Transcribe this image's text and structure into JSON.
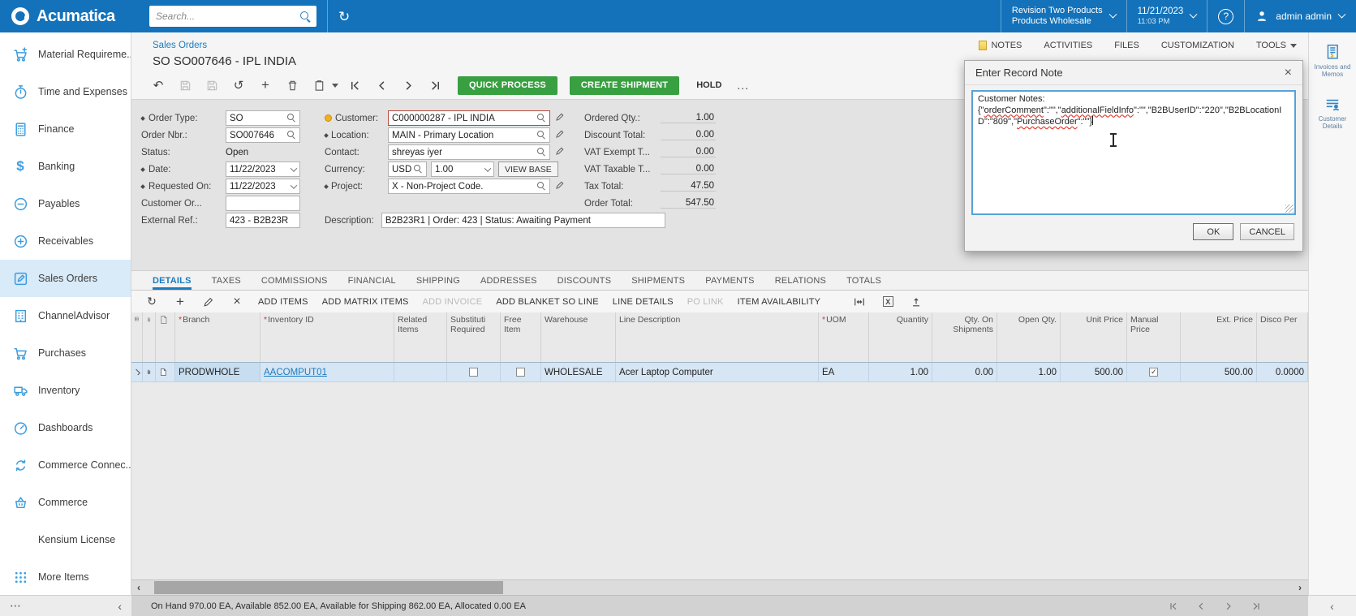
{
  "colors": {
    "topbar_blue": "#1372ba",
    "accent_blue": "#1a7bc0",
    "sidebar_icon_blue": "#3b9de0",
    "action_green": "#38a040",
    "selected_row": "#d7e6f4",
    "error_red": "#bb4a42",
    "warning_amber": "#f2b01e"
  },
  "topbar": {
    "brand": "Acumatica",
    "search_placeholder": "Search...",
    "company": {
      "line1": "Revision Two Products",
      "line2": "Products Wholesale"
    },
    "datetime": {
      "date": "11/21/2023",
      "time": "11:03 PM"
    },
    "help": "?",
    "user": "admin admin"
  },
  "sidebar": {
    "items": [
      {
        "label": "Material Requireme...",
        "icon": "cart-plus-icon"
      },
      {
        "label": "Time and Expenses",
        "icon": "stopwatch-icon"
      },
      {
        "label": "Finance",
        "icon": "calculator-icon"
      },
      {
        "label": "Banking",
        "icon": "dollar-icon"
      },
      {
        "label": "Payables",
        "icon": "minus-circle-icon"
      },
      {
        "label": "Receivables",
        "icon": "plus-circle-icon"
      },
      {
        "label": "Sales Orders",
        "icon": "pencil-square-icon",
        "selected": true
      },
      {
        "label": "ChannelAdvisor",
        "icon": "building-icon"
      },
      {
        "label": "Purchases",
        "icon": "cart-icon"
      },
      {
        "label": "Inventory",
        "icon": "truck-icon"
      },
      {
        "label": "Dashboards",
        "icon": "gauge-icon"
      },
      {
        "label": "Commerce Connec...",
        "icon": "sync-icon"
      },
      {
        "label": "Commerce",
        "icon": "basket-icon"
      },
      {
        "label": "Kensium License",
        "icon": ""
      },
      {
        "label": "More Items",
        "icon": "grid-dots-icon"
      }
    ],
    "footer": {
      "more": "⋯",
      "collapse": "‹"
    }
  },
  "header": {
    "breadcrumb": "Sales Orders",
    "title": "SO SO007646 - IPL INDIA",
    "links": {
      "notes": "NOTES",
      "activities": "ACTIVITIES",
      "files": "FILES",
      "customization": "CUSTOMIZATION",
      "tools": "TOOLS"
    },
    "buttons": {
      "quick_process": "QUICK PROCESS",
      "create_shipment": "CREATE SHIPMENT",
      "hold": "HOLD",
      "more": "..."
    }
  },
  "form": {
    "left": {
      "order_type": {
        "label": "Order Type:",
        "value": "SO"
      },
      "order_nbr": {
        "label": "Order Nbr.:",
        "value": "SO007646"
      },
      "status": {
        "label": "Status:",
        "value": "Open"
      },
      "date": {
        "label": "Date:",
        "value": "11/22/2023"
      },
      "requested_on": {
        "label": "Requested On:",
        "value": "11/22/2023"
      },
      "customer_order": {
        "label": "Customer Or...",
        "value": ""
      },
      "external_ref": {
        "label": "External Ref.:",
        "value": "423 - B2B23R"
      }
    },
    "mid": {
      "customer": {
        "label": "Customer:",
        "value": "C000000287 - IPL INDIA"
      },
      "location": {
        "label": "Location:",
        "value": "MAIN - Primary Location"
      },
      "contact": {
        "label": "Contact:",
        "value": "shreyas iyer"
      },
      "currency": {
        "label": "Currency:",
        "code": "USD",
        "rate": "1.00",
        "view_base": "VIEW BASE"
      },
      "project": {
        "label": "Project:",
        "value": "X - Non-Project Code."
      },
      "description": {
        "label": "Description:",
        "value": "B2B23R1 | Order: 423 | Status: Awaiting Payment"
      }
    },
    "totals": {
      "ordered_qty": {
        "label": "Ordered Qty.:",
        "value": "1.00"
      },
      "discount_total": {
        "label": "Discount Total:",
        "value": "0.00"
      },
      "vat_exempt": {
        "label": "VAT Exempt T...",
        "value": "0.00"
      },
      "vat_taxable": {
        "label": "VAT Taxable T...",
        "value": "0.00"
      },
      "tax_total": {
        "label": "Tax Total:",
        "value": "47.50"
      },
      "order_total": {
        "label": "Order Total:",
        "value": "547.50"
      }
    }
  },
  "tabs": [
    "DETAILS",
    "TAXES",
    "COMMISSIONS",
    "FINANCIAL",
    "SHIPPING",
    "ADDRESSES",
    "DISCOUNTS",
    "SHIPMENTS",
    "PAYMENTS",
    "RELATIONS",
    "TOTALS"
  ],
  "grid": {
    "toolbar": [
      "ADD ITEMS",
      "ADD MATRIX ITEMS",
      "ADD INVOICE",
      "ADD BLANKET SO LINE",
      "LINE DETAILS",
      "PO LINK",
      "ITEM AVAILABILITY"
    ],
    "columns": [
      {
        "label": "Branch",
        "required": true
      },
      {
        "label": "Inventory ID",
        "required": true
      },
      {
        "label": "Related Items"
      },
      {
        "label": "Substituti Required"
      },
      {
        "label": "Free Item"
      },
      {
        "label": "Warehouse"
      },
      {
        "label": "Line Description"
      },
      {
        "label": "UOM",
        "required": true
      },
      {
        "label": "Quantity"
      },
      {
        "label": "Qty. On Shipments"
      },
      {
        "label": "Open Qty."
      },
      {
        "label": "Unit Price"
      },
      {
        "label": "Manual Price"
      },
      {
        "label": "Ext. Price"
      },
      {
        "label": "Disco Per"
      }
    ],
    "row": {
      "branch": "PRODWHOLE",
      "inventory_id": "AACOMPUT01",
      "related_items": "",
      "substitution_required": false,
      "free_item": false,
      "warehouse": "WHOLESALE",
      "line_description": "Acer Laptop Computer",
      "uom": "EA",
      "quantity": "1.00",
      "qty_on_shipments": "0.00",
      "open_qty": "1.00",
      "unit_price": "500.00",
      "manual_price": true,
      "ext_price": "500.00",
      "discount_percent": "0.0000"
    }
  },
  "scrollbar": {
    "left": "‹",
    "right": "›"
  },
  "statusbar": {
    "summary": "On Hand 970.00 EA, Available 852.00 EA, Available for Shipping 862.00 EA, Allocated 0.00 EA"
  },
  "right_panel": {
    "invoices": "Invoices and Memos",
    "customer_details": "Customer Details",
    "collapse": "‹"
  },
  "dialog": {
    "title": "Enter Record Note",
    "close": "×",
    "note_label": "Customer Notes:",
    "note_segments": [
      {
        "t": "{\""
      },
      {
        "t": "orderComment"
      },
      {
        "t": "\":\"\",\""
      },
      {
        "t": "additionalFieldInfo"
      },
      {
        "t": "\":\"\",\"B2BUserID\":\"220\",\"B2BLocationID\":\"809\",\""
      },
      {
        "t": "PurchaseOrder"
      },
      {
        "t": "\":\"\"}"
      }
    ],
    "ok": "OK",
    "cancel": "CANCEL"
  }
}
